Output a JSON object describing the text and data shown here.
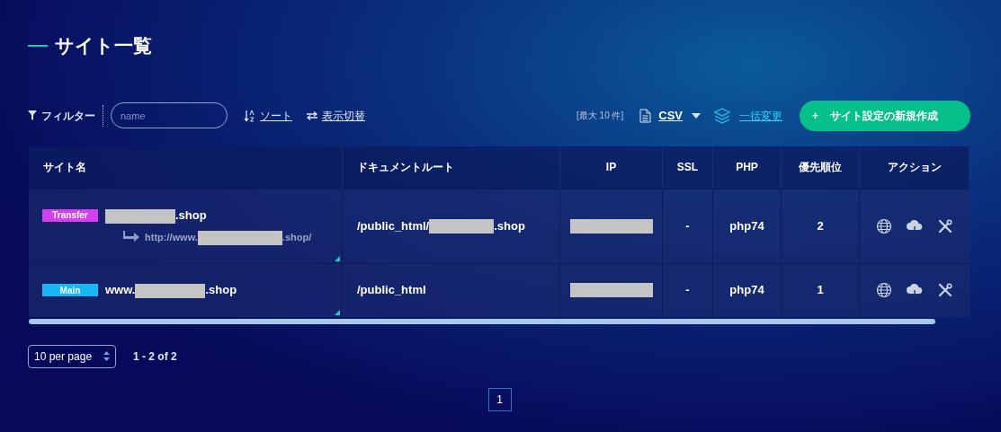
{
  "title": "サイト一覧",
  "toolbar": {
    "filter_label": "フィルター",
    "filter_placeholder": "name",
    "sort_label": "ソート",
    "view_label": "表示切替",
    "max_note": "[最大 10 件]",
    "csv_label": "CSV",
    "bulk_label": "一括変更",
    "create_button": "サイト設定の新規作成",
    "create_icon": "+"
  },
  "table": {
    "columns": [
      "サイト名",
      "ドキュメントルート",
      "IP",
      "SSL",
      "PHP",
      "優先順位",
      "アクション"
    ],
    "rows": [
      {
        "badge": {
          "label": "Transfer",
          "kind": "transfer"
        },
        "site_parts": {
          "after": ".shop"
        },
        "redirect_parts": {
          "before": "http://www.",
          "after": ".shop/"
        },
        "docroot_parts": {
          "before": "/public_html/",
          "after": ".shop"
        },
        "ssl": "-",
        "php": "php74",
        "priority": "2"
      },
      {
        "badge": {
          "label": "Main",
          "kind": "main"
        },
        "site_parts": {
          "before": "www.",
          "after": ".shop"
        },
        "docroot_parts": {
          "before": "/public_html"
        },
        "ssl": "-",
        "php": "php74",
        "priority": "1"
      }
    ]
  },
  "pagination": {
    "per_page": "10 per page",
    "range": "1 - 2 of 2",
    "pages": [
      {
        "label": "1",
        "selected": true
      }
    ]
  }
}
